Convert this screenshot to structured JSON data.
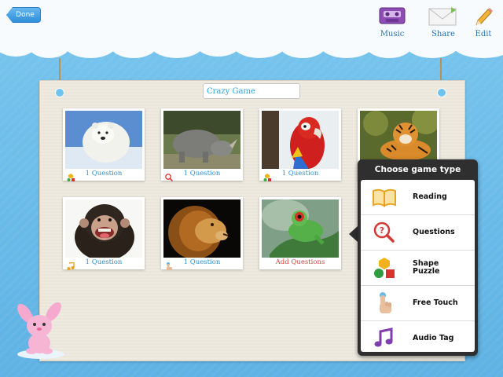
{
  "toolbar": {
    "done_label": "Done",
    "music_label": "Music",
    "share_label": "Share",
    "edit_label": "Edit"
  },
  "board": {
    "title": "Crazy Game"
  },
  "cards": [
    {
      "label": "1 Question",
      "animal": "polar bear",
      "icon": "shape-puzzle-icon"
    },
    {
      "label": "1 Question",
      "animal": "rhinoceros",
      "icon": "questions-icon"
    },
    {
      "label": "1 Question",
      "animal": "macaw",
      "icon": "shape-puzzle-icon"
    },
    {
      "label": "",
      "animal": "tiger",
      "icon": ""
    },
    {
      "label": "1 Question",
      "animal": "chimpanzee",
      "icon": "audio-tag-icon"
    },
    {
      "label": "1 Question",
      "animal": "lion",
      "icon": "free-touch-icon"
    },
    {
      "label": "Add Questions",
      "animal": "tree frog",
      "icon": ""
    }
  ],
  "popover": {
    "title": "Choose game type",
    "items": [
      {
        "label": "Reading",
        "icon": "book-icon"
      },
      {
        "label": "Questions",
        "icon": "magnifier-question-icon"
      },
      {
        "label_line1": "Shape",
        "label_line2": "Puzzle",
        "icon": "shapes-icon"
      },
      {
        "label": "Free Touch",
        "icon": "finger-touch-icon"
      },
      {
        "label": "Audio Tag",
        "icon": "music-note-icon"
      }
    ]
  },
  "colors": {
    "sky": "#67b9e7",
    "accent_blue": "#2e8fd1",
    "add_red": "#d0463f",
    "popover_bg": "#2f2f2f"
  }
}
